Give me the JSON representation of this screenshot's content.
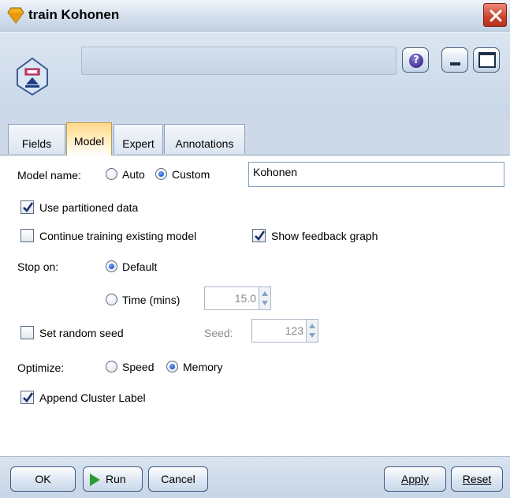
{
  "window": {
    "title": "train Kohonen"
  },
  "header": {
    "node_name": ""
  },
  "tabs": [
    {
      "label": "Fields",
      "active": false
    },
    {
      "label": "Model",
      "active": true
    },
    {
      "label": "Expert",
      "active": false
    },
    {
      "label": "Annotations",
      "active": false
    }
  ],
  "model_tab": {
    "model_name": {
      "label": "Model name:",
      "option_auto": "Auto",
      "option_custom": "Custom",
      "selected": "Custom",
      "value": "Kohonen"
    },
    "use_partitioned_data": {
      "label": "Use partitioned data",
      "checked": true
    },
    "continue_training": {
      "label": "Continue training existing model",
      "checked": false
    },
    "show_feedback_graph": {
      "label": "Show feedback graph",
      "checked": true
    },
    "stop_on": {
      "label": "Stop on:",
      "option_default": "Default",
      "option_time": "Time (mins)",
      "selected": "Default",
      "time_value": "15.0"
    },
    "random_seed": {
      "label": "Set random seed",
      "checked": false,
      "seed_label": "Seed:",
      "seed_value": "123"
    },
    "optimize": {
      "label": "Optimize:",
      "option_speed": "Speed",
      "option_memory": "Memory",
      "selected": "Memory"
    },
    "append_cluster_label": {
      "label": "Append Cluster Label",
      "checked": true
    }
  },
  "buttons": {
    "ok": "OK",
    "run": "Run",
    "cancel": "Cancel",
    "apply": "Apply",
    "reset": "Reset"
  },
  "colors": {
    "active_tab": "#ffd98a",
    "header_band": "#c9d7e8",
    "close_button": "#c9442c",
    "run_icon": "#2f9a2f"
  }
}
